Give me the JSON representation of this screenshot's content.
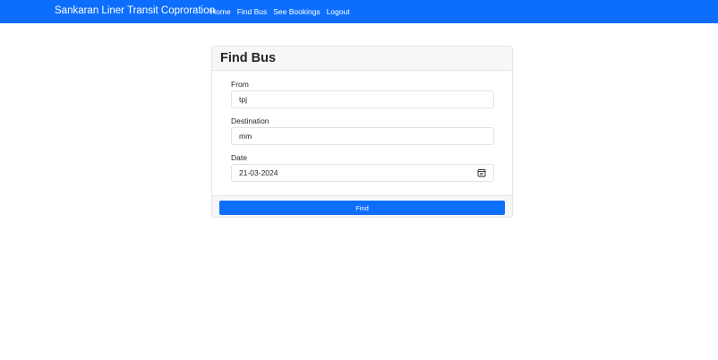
{
  "navbar": {
    "brand": "Sankaran Liner Transit Coproration",
    "links": [
      {
        "label": "Home"
      },
      {
        "label": "Find Bus"
      },
      {
        "label": "See Bookings"
      },
      {
        "label": "Logout"
      }
    ],
    "background_color": "#0d6efd"
  },
  "form": {
    "title": "Find Bus",
    "from": {
      "label": "From",
      "value": "tpj"
    },
    "destination": {
      "label": "Destination",
      "value": "mm"
    },
    "date": {
      "label": "Date",
      "value": "21-03-2024",
      "icon": "calendar-icon"
    },
    "submit_label": "Find",
    "button_color": "#0d6efd"
  }
}
